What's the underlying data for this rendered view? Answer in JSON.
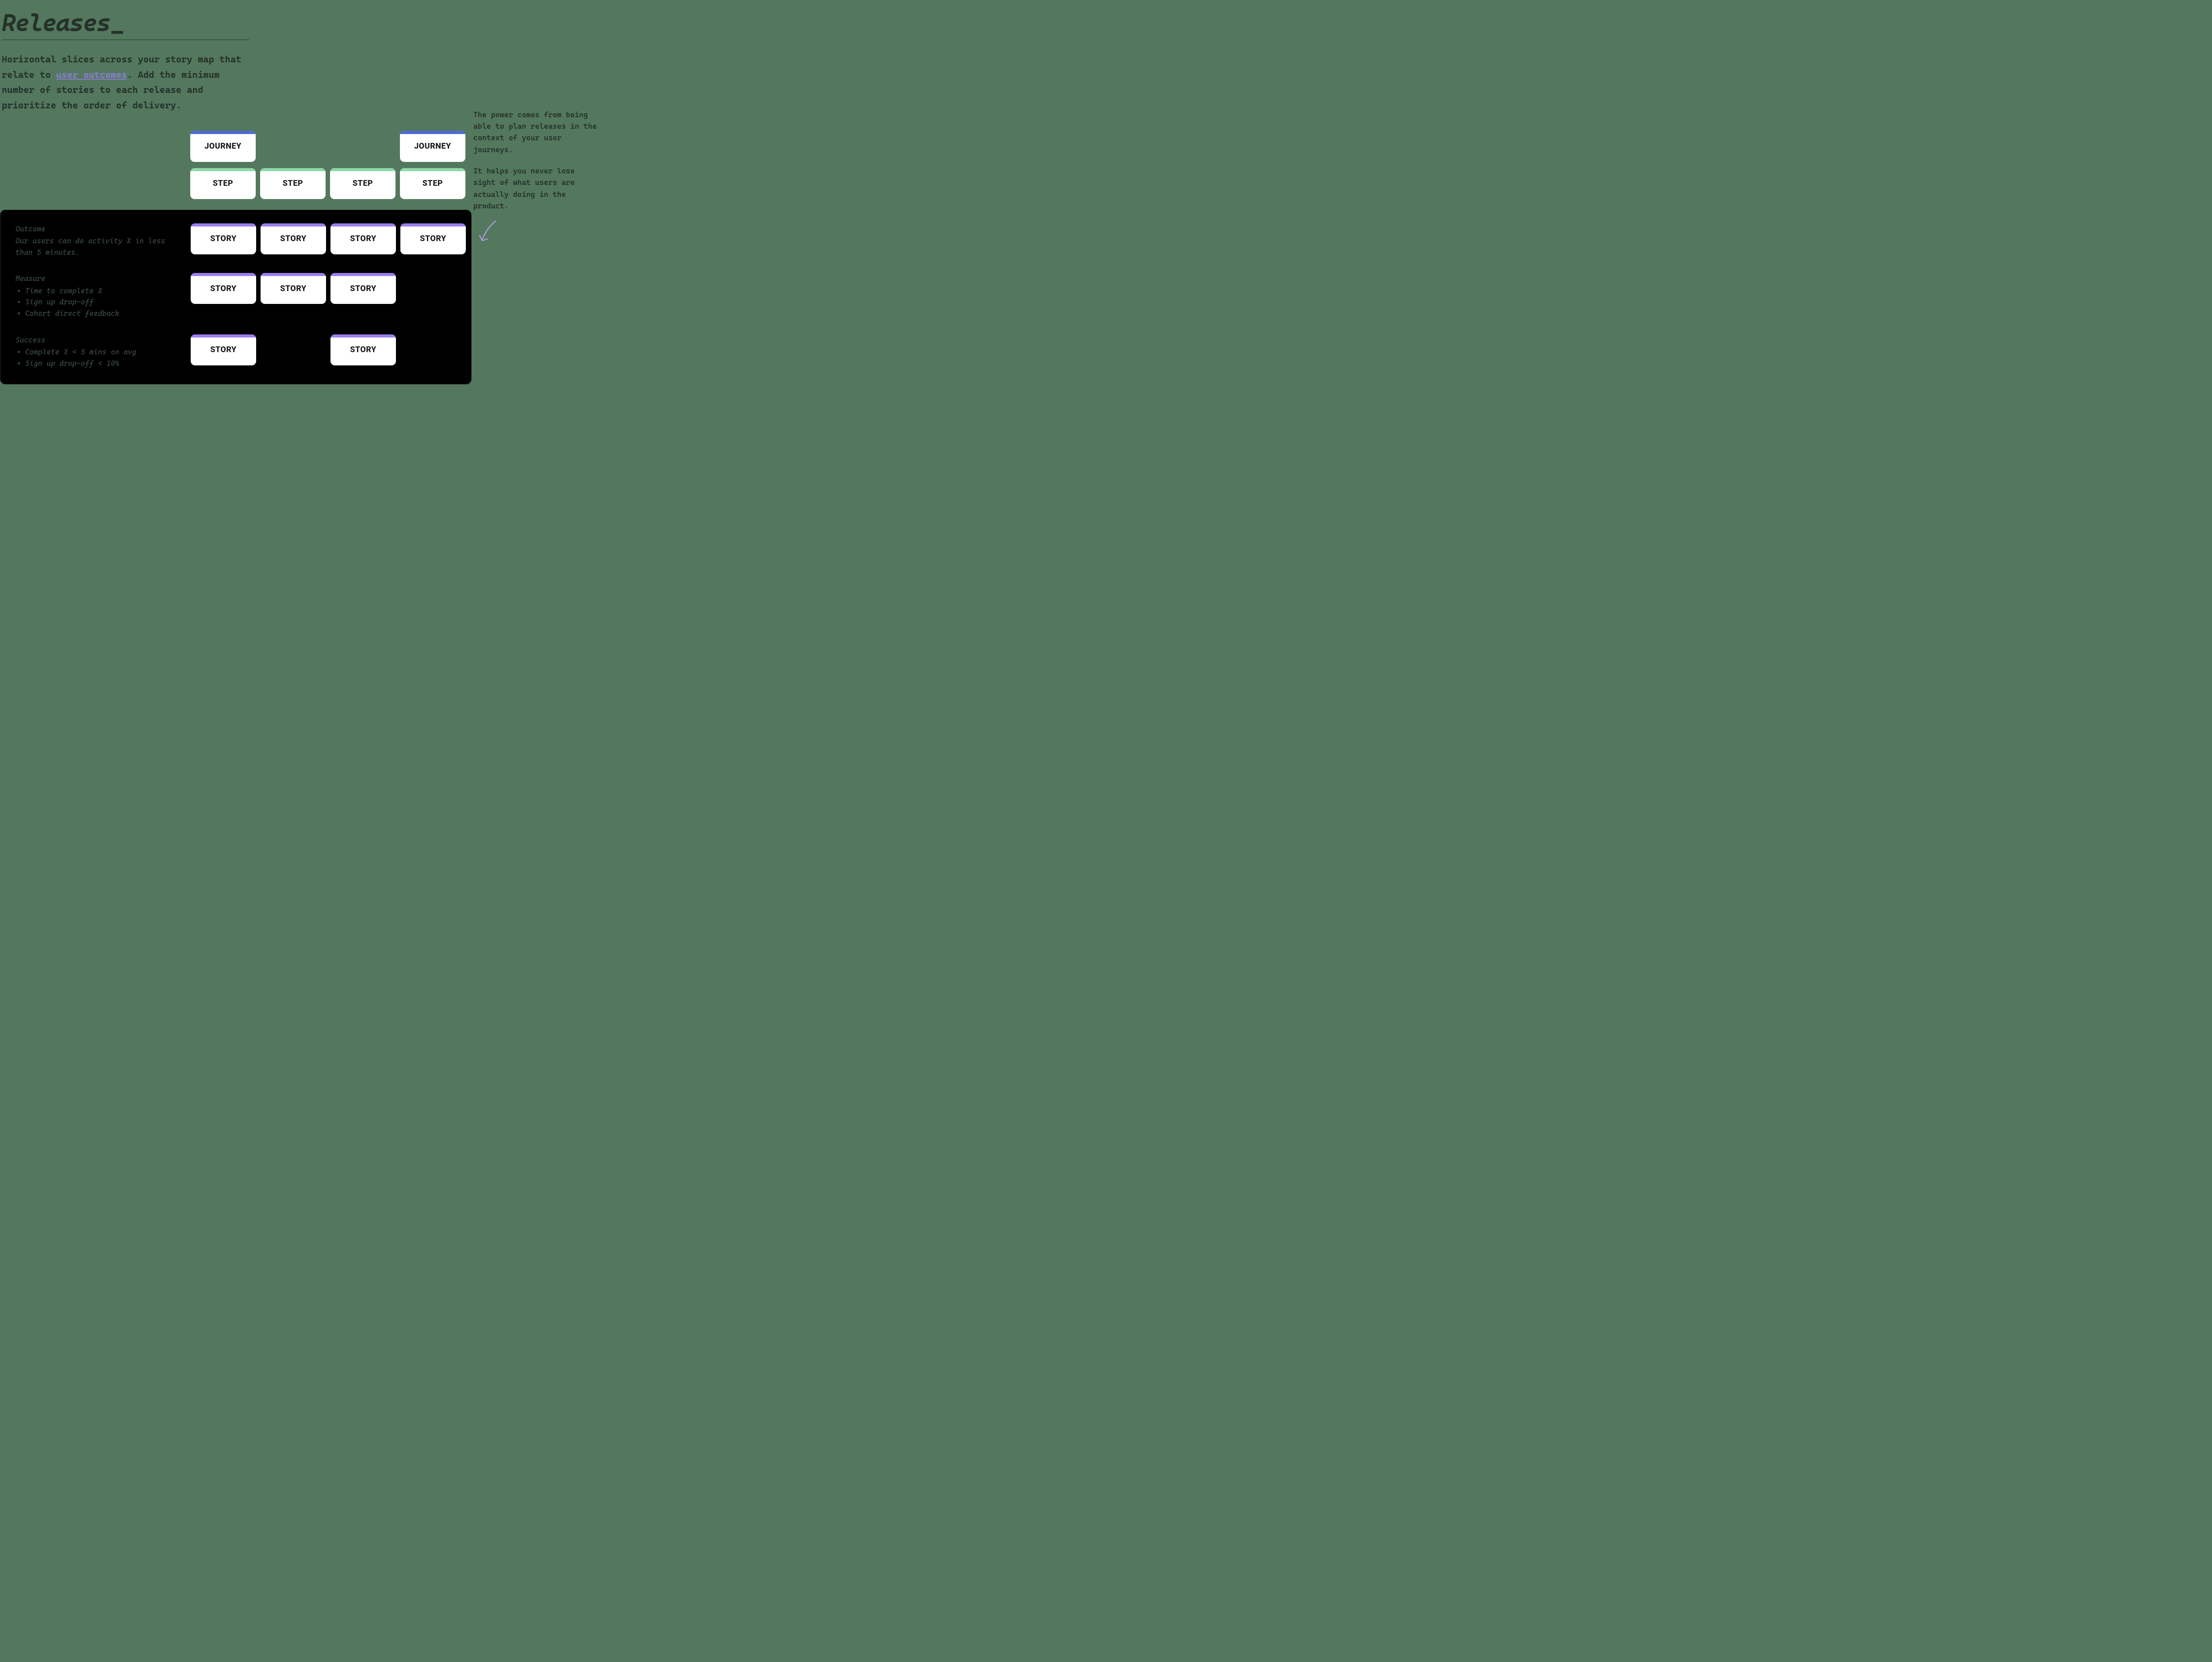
{
  "header": {
    "title": "Releases",
    "cursor": "_",
    "intro_before_link": "Horizontal slices across your story map that relate to ",
    "intro_link": "user outcomes",
    "intro_after_link": ". Add the minimum number of stories to each release and prioritize the order of delivery."
  },
  "sidenote": {
    "p1": "The power comes from being able to plan releases in the context of your user journeys.",
    "p2": "It helps you never lose sight of what users are actually doing in the product."
  },
  "cards": {
    "journey": "JOURNEY",
    "step": "STEP",
    "story": "STORY"
  },
  "panel": {
    "outcome_h": "Outcome",
    "outcome_body": "Our users can do activity X in less than 5 minutes.",
    "measure_h": "Measure",
    "measure_items": [
      "Time to complete X",
      "Sign up drop-off",
      "Cohort direct feedback"
    ],
    "success_h": "Success",
    "success_items": [
      "Complete X < 5 mins on avg",
      "Sign up drop-off < 10%"
    ]
  },
  "map": {
    "journey_row": [
      "journey",
      null,
      null,
      "journey"
    ],
    "step_row": [
      "step",
      "step",
      "step",
      "step"
    ],
    "story_rows": [
      [
        "story",
        "story",
        "story",
        "story"
      ],
      [
        "story",
        "story",
        "story",
        null
      ],
      [
        "story",
        null,
        "story",
        null
      ]
    ]
  }
}
